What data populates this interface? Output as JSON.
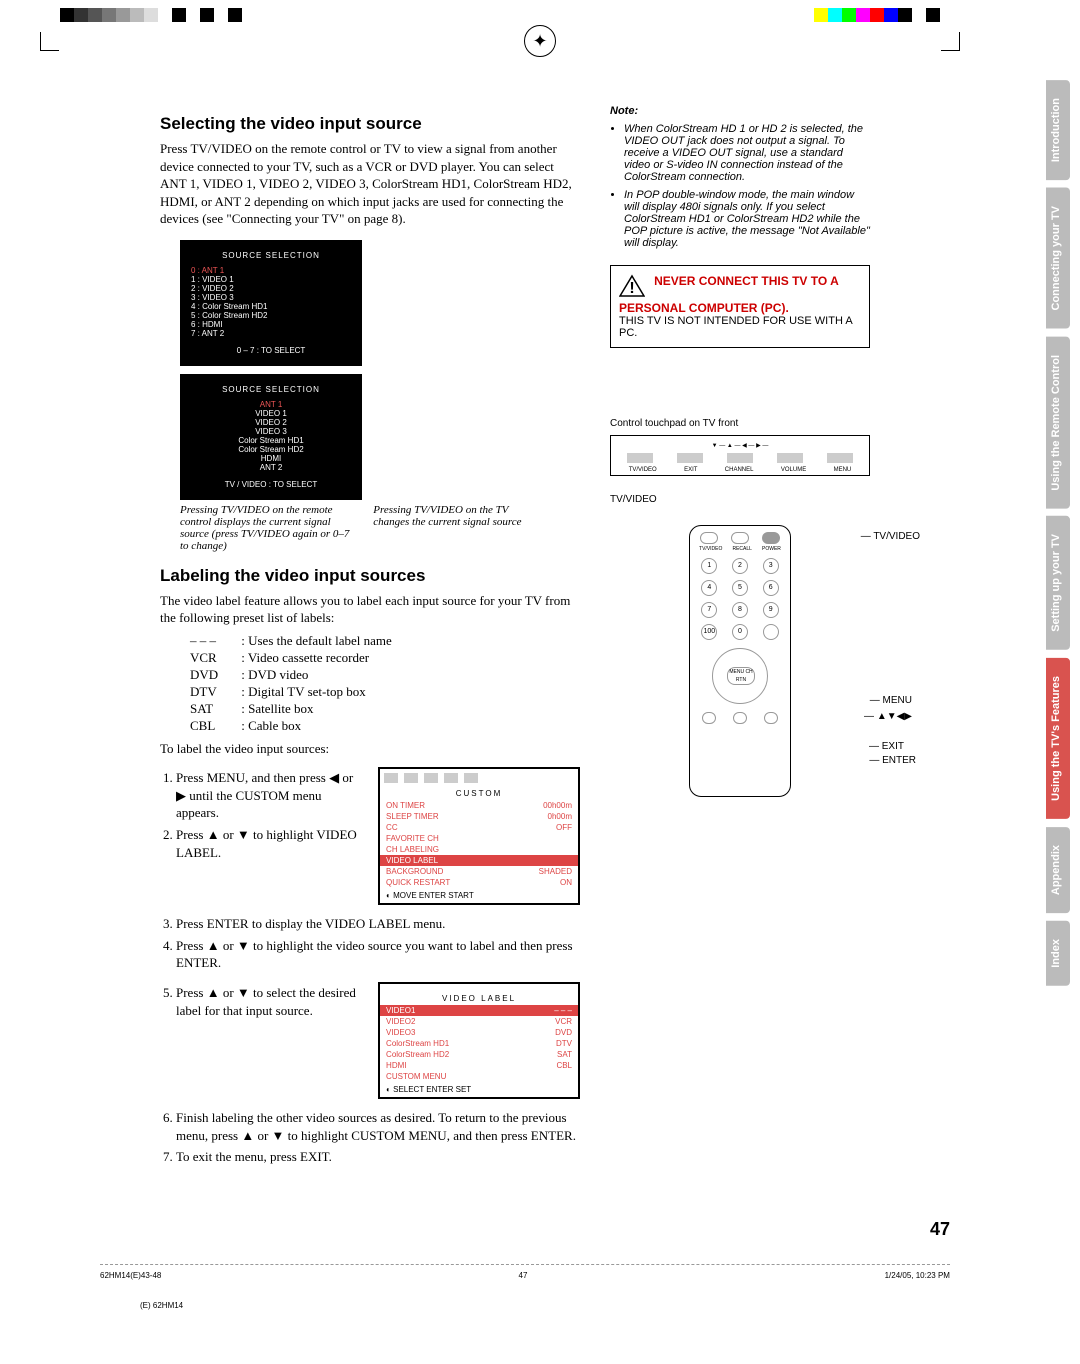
{
  "colorbar1": [
    "#000",
    "#333",
    "#555",
    "#777",
    "#999",
    "#bbb",
    "#ddd",
    "#fff",
    "#000",
    "#fff",
    "#000",
    "#fff",
    "#000",
    "#fff"
  ],
  "colorbar2": [
    "#fff",
    "#ff0",
    "#0ff",
    "#0f0",
    "#f0f",
    "#f00",
    "#00f",
    "#000",
    "#fff",
    "#000"
  ],
  "tabs": [
    {
      "label": "Introduction",
      "cls": "g"
    },
    {
      "label": "Connecting your TV",
      "cls": "g"
    },
    {
      "label": "Using the Remote Control",
      "cls": "g"
    },
    {
      "label": "Setting up your TV",
      "cls": "g"
    },
    {
      "label": "Using the TV's Features",
      "cls": "r"
    },
    {
      "label": "Appendix",
      "cls": "g"
    },
    {
      "label": "Index",
      "cls": "g"
    }
  ],
  "h1": "Selecting the video input source",
  "p1": "Press TV/VIDEO on the remote control or TV to view a signal from another device connected to your TV, such as a VCR or DVD player. You can select ANT 1, VIDEO 1, VIDEO 2, VIDEO 3, ColorStream HD1, ColorStream HD2, HDMI, or ANT 2 depending on which input jacks are used for connecting the devices (see \"Connecting your TV\" on page 8).",
  "osd1": {
    "title": "SOURCE SELECTION",
    "items": [
      "0 : ANT 1",
      "1 : VIDEO 1",
      "2 : VIDEO 2",
      "3 : VIDEO 3",
      "4 : Color Stream HD1",
      "5 : Color Stream HD2",
      "6 : HDMI",
      "7 : ANT 2"
    ],
    "foot": "0 – 7 : TO SELECT"
  },
  "osd2": {
    "title": "SOURCE SELECTION",
    "items": [
      "ANT 1",
      "VIDEO 1",
      "VIDEO 2",
      "VIDEO 3",
      "Color Stream HD1",
      "Color Stream HD2",
      "HDMI",
      "ANT 2"
    ],
    "foot": "TV / VIDEO : TO SELECT"
  },
  "cap1": "Pressing TV/VIDEO on the remote control displays the current signal source (press TV/VIDEO again or 0–7 to change)",
  "cap2": "Pressing TV/VIDEO on the TV changes the current signal source",
  "h2": "Labeling the video input sources",
  "p2": "The video label feature allows you to label each input source for your TV from the following preset list of labels:",
  "defs": [
    {
      "k": "– – –",
      "v": ": Uses the default label name"
    },
    {
      "k": "VCR",
      "v": ": Video cassette recorder"
    },
    {
      "k": "DVD",
      "v": ": DVD video"
    },
    {
      "k": "DTV",
      "v": ": Digital TV set-top box"
    },
    {
      "k": "SAT",
      "v": ": Satellite box"
    },
    {
      "k": "CBL",
      "v": ": Cable box"
    }
  ],
  "p3": "To label the video input sources:",
  "steps": [
    "Press MENU, and then press ◀ or ▶ until the CUSTOM menu appears.",
    "Press ▲ or ▼ to highlight VIDEO LABEL.",
    "Press ENTER to display the VIDEO LABEL menu.",
    "Press ▲ or ▼ to highlight the video source you want to label and then press ENTER.",
    "Press ▲ or ▼ to select the desired label for that input source.",
    "Finish labeling the other video sources as desired. To return to the previous menu, press ▲ or ▼ to highlight CUSTOM MENU, and then press ENTER.",
    "To exit the menu, press EXIT."
  ],
  "customMenu": {
    "title": "CUSTOM",
    "rows": [
      {
        "l": "ON TIMER",
        "r": "00h00m"
      },
      {
        "l": "SLEEP TIMER",
        "r": "0h00m"
      },
      {
        "l": "CC",
        "r": "OFF"
      },
      {
        "l": "FAVORITE CH",
        "r": ""
      },
      {
        "l": "CH LABELING",
        "r": ""
      },
      {
        "l": "VIDEO LABEL",
        "r": "",
        "hl": true
      },
      {
        "l": "BACKGROUND",
        "r": "SHADED"
      },
      {
        "l": "QUICK RESTART",
        "r": "ON"
      }
    ],
    "foot": "◐ MOVE   ENTER  START"
  },
  "labelMenu": {
    "title": "VIDEO LABEL",
    "rows": [
      {
        "l": "VIDEO1",
        "r": "– – –",
        "hl": true
      },
      {
        "l": "VIDEO2",
        "r": "VCR"
      },
      {
        "l": "VIDEO3",
        "r": "DVD"
      },
      {
        "l": "ColorStream HD1",
        "r": "DTV"
      },
      {
        "l": "ColorStream HD2",
        "r": "SAT"
      },
      {
        "l": "HDMI",
        "r": "CBL"
      },
      {
        "l": "CUSTOM MENU",
        "r": ""
      }
    ],
    "foot": "◐ SELECT   ENTER  SET"
  },
  "notehdr": "Note:",
  "notes": [
    "When ColorStream HD 1 or HD 2 is selected, the VIDEO OUT jack does not output a signal. To receive a VIDEO OUT signal, use a standard video or S-video IN connection instead of the ColorStream connection.",
    "In POP double-window mode, the main window will display 480i signals only. If you select ColorStream HD1 or ColorStream HD2 while the POP picture is active, the message \"Not Available\" will display."
  ],
  "warn": {
    "t1": "NEVER CONNECT THIS TV TO A PERSONAL COMPUTER (PC).",
    "t2": "THIS TV IS NOT INTENDED FOR USE WITH A PC."
  },
  "touchpad": {
    "hdr": "Control touchpad on TV front",
    "labels": [
      "TV/VIDEO",
      "EXIT",
      "CHANNEL",
      "VOLUME",
      "MENU"
    ],
    "sub": "TV/VIDEO"
  },
  "remoteLabels": {
    "a": "TV/VIDEO",
    "b": "MENU",
    "c": "▲▼◀▶",
    "d": "EXIT",
    "e": "ENTER"
  },
  "remote": {
    "top": [
      "TV/VIDEO",
      "RECALL",
      "POWER"
    ],
    "ctr": "MENU\nCH RTN"
  },
  "pagenum": "47",
  "footer": {
    "l": "62HM14(E)43-48",
    "c": "47",
    "r": "1/24/05, 10:23 PM"
  },
  "imposition": "(E) 62HM14"
}
